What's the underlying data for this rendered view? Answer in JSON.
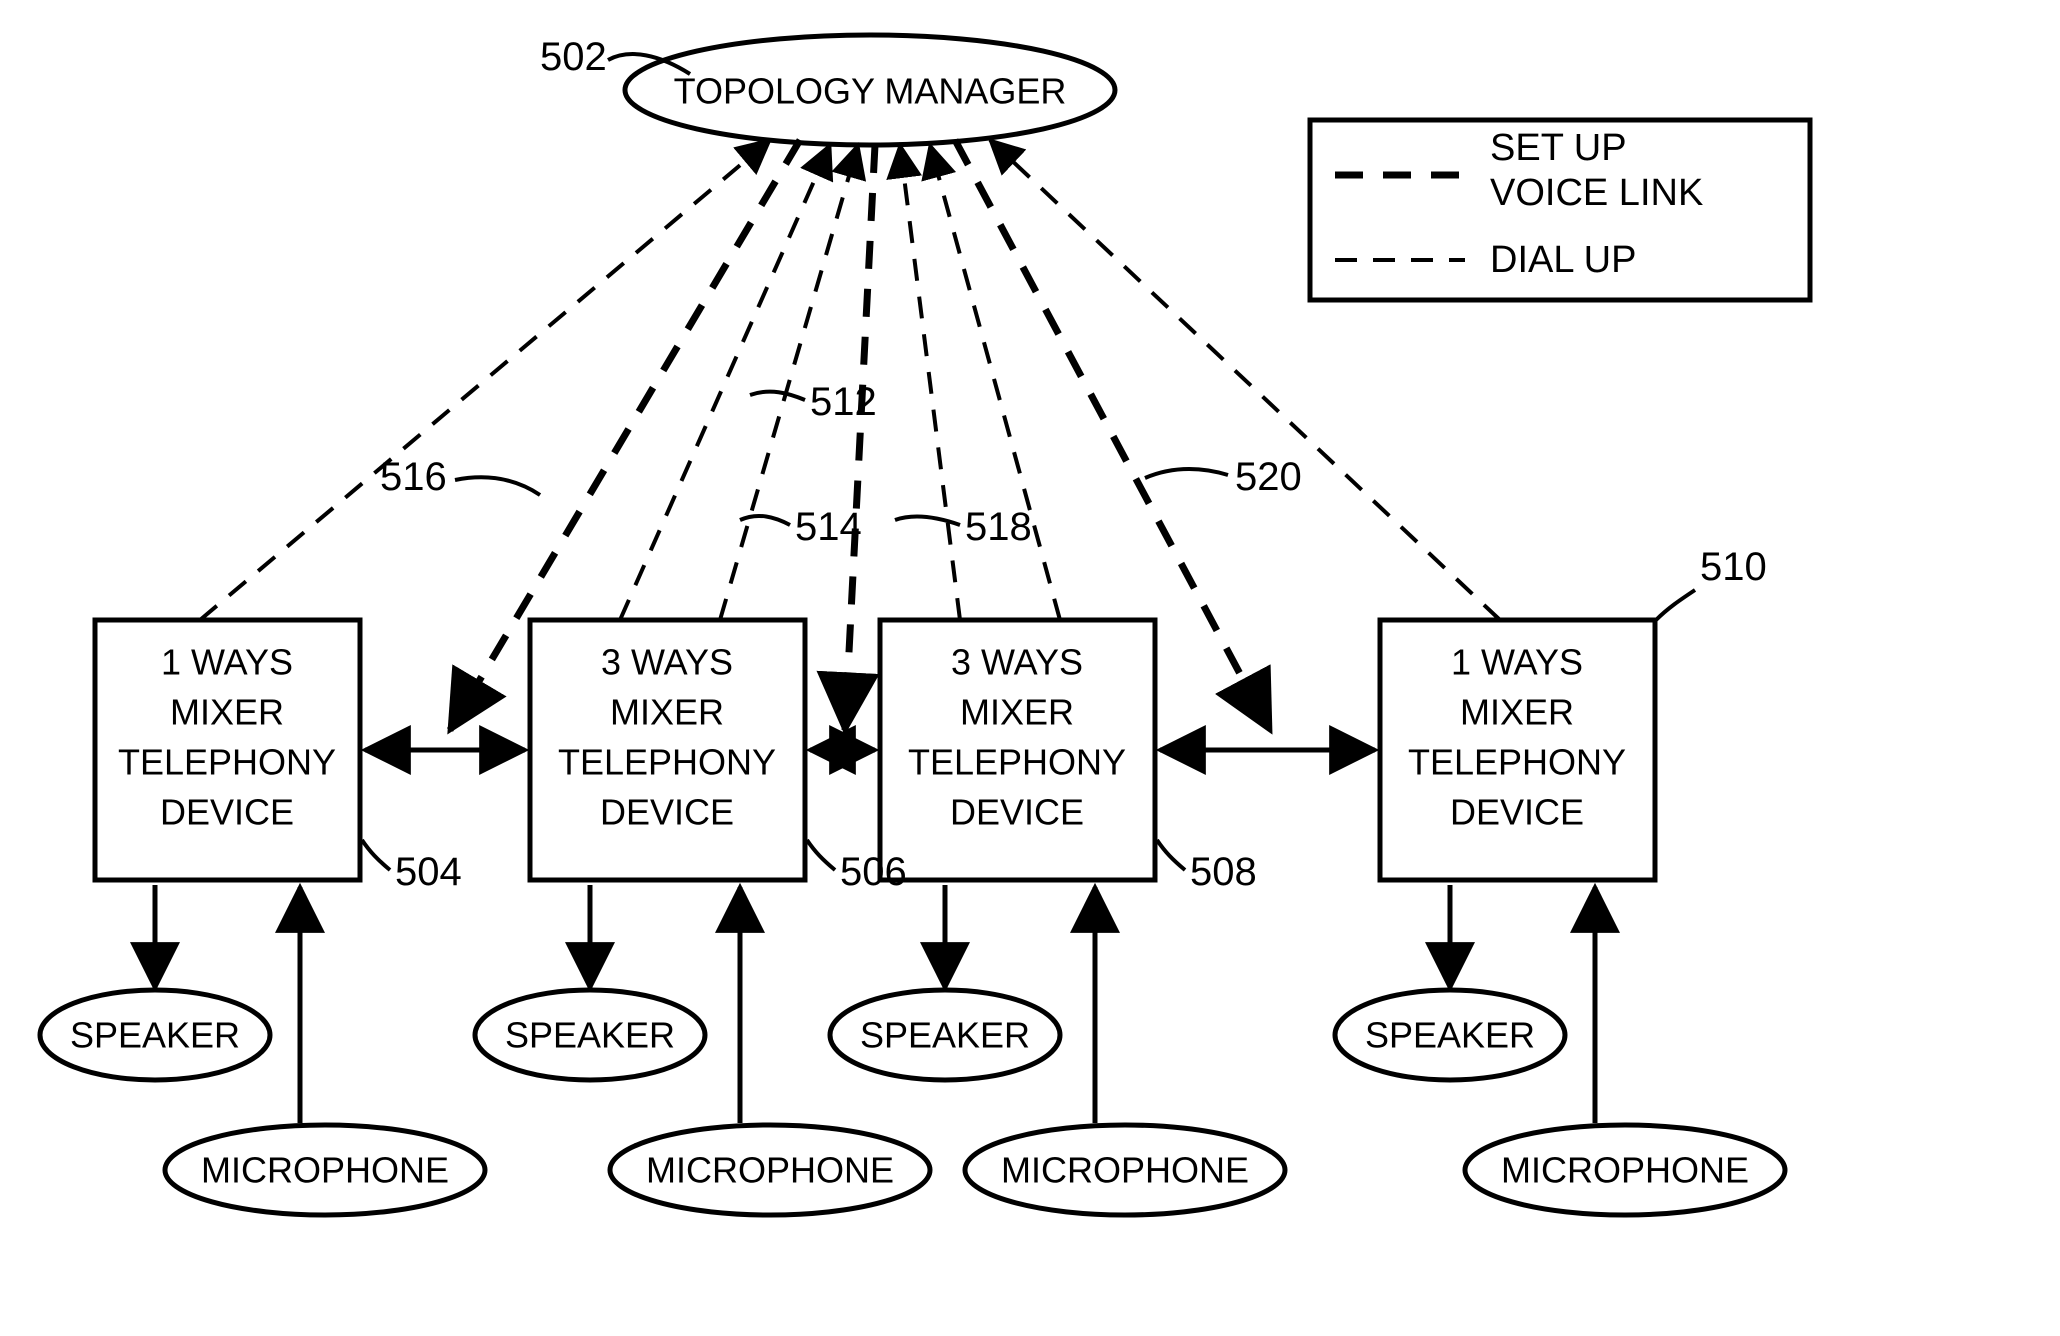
{
  "topologyManager": {
    "label": "TOPOLOGY MANAGER",
    "ref": "502"
  },
  "legend": {
    "setup": "SET UP\nVOICE LINK",
    "dialup": "DIAL UP"
  },
  "devices": [
    {
      "id": "504",
      "lines": [
        "1 WAYS",
        "MIXER",
        "TELEPHONY",
        "DEVICE"
      ],
      "speaker": "SPEAKER",
      "mic": "MICROPHONE"
    },
    {
      "id": "506",
      "lines": [
        "3 WAYS",
        "MIXER",
        "TELEPHONY",
        "DEVICE"
      ],
      "speaker": "SPEAKER",
      "mic": "MICROPHONE"
    },
    {
      "id": "508",
      "lines": [
        "3 WAYS",
        "MIXER",
        "TELEPHONY",
        "DEVICE"
      ],
      "speaker": "SPEAKER",
      "mic": "MICROPHONE"
    },
    {
      "id": "510",
      "lines": [
        "1 WAYS",
        "MIXER",
        "TELEPHONY",
        "DEVICE"
      ],
      "speaker": "SPEAKER",
      "mic": "MICROPHONE"
    }
  ],
  "linkLabels": {
    "512": "512",
    "514": "514",
    "516": "516",
    "518": "518",
    "520": "520"
  }
}
